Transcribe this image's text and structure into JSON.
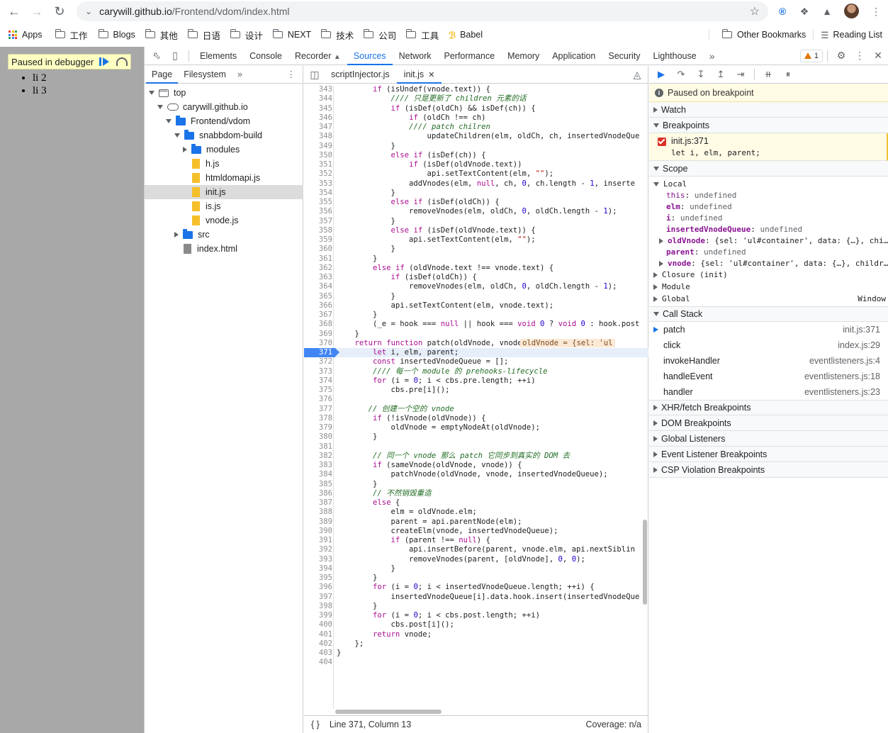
{
  "browser": {
    "url_host": "carywill.github.io",
    "url_path": "/Frontend/vdom/index.html",
    "bookmarks": [
      "Apps",
      "工作",
      "Blogs",
      "其他",
      "日语",
      "设计",
      "NEXT",
      "技术",
      "公司",
      "工具",
      "Babel"
    ],
    "other_bookmarks": "Other Bookmarks",
    "reading_list": "Reading List"
  },
  "page": {
    "paused_text": "Paused in debugger",
    "items": [
      "li 2",
      "li 3"
    ]
  },
  "devtools": {
    "tabs": [
      "Elements",
      "Console",
      "Recorder",
      "Sources",
      "Network",
      "Performance",
      "Memory",
      "Application",
      "Security",
      "Lighthouse"
    ],
    "active_tab": "Sources",
    "warnings": "1",
    "nav_tabs": [
      "Page",
      "Filesystem"
    ],
    "tree": [
      "top",
      "carywill.github.io",
      "Frontend/vdom",
      "snabbdom-build",
      "modules",
      "h.js",
      "htmldomapi.js",
      "init.js",
      "is.js",
      "vnode.js",
      "src",
      "index.html"
    ],
    "editor_tabs": [
      "scriptInjector.js",
      "init.js"
    ],
    "status_position": "Line 371, Column 13",
    "coverage": "Coverage: n/a",
    "inline_value": "oldVnode = {sel: 'ul",
    "code": [
      {
        "n": "343",
        "t": "        if (isUndef(vnode.text)) {"
      },
      {
        "n": "344",
        "t": "            //// 只是更新了 children 元素的话"
      },
      {
        "n": "345",
        "t": "            if (isDef(oldCh) && isDef(ch)) {"
      },
      {
        "n": "346",
        "t": "                if (oldCh !== ch)"
      },
      {
        "n": "347",
        "t": "                //// patch chilren"
      },
      {
        "n": "348",
        "t": "                    updateChildren(elm, oldCh, ch, insertedVnodeQue"
      },
      {
        "n": "349",
        "t": "            }"
      },
      {
        "n": "350",
        "t": "            else if (isDef(ch)) {"
      },
      {
        "n": "351",
        "t": "                if (isDef(oldVnode.text))"
      },
      {
        "n": "352",
        "t": "                    api.setTextContent(elm, \"\");"
      },
      {
        "n": "353",
        "t": "                addVnodes(elm, null, ch, 0, ch.length - 1, inserte"
      },
      {
        "n": "354",
        "t": "            }"
      },
      {
        "n": "355",
        "t": "            else if (isDef(oldCh)) {"
      },
      {
        "n": "356",
        "t": "                removeVnodes(elm, oldCh, 0, oldCh.length - 1);"
      },
      {
        "n": "357",
        "t": "            }"
      },
      {
        "n": "358",
        "t": "            else if (isDef(oldVnode.text)) {"
      },
      {
        "n": "359",
        "t": "                api.setTextContent(elm, \"\");"
      },
      {
        "n": "360",
        "t": "            }"
      },
      {
        "n": "361",
        "t": "        }"
      },
      {
        "n": "362",
        "t": "        else if (oldVnode.text !== vnode.text) {"
      },
      {
        "n": "363",
        "t": "            if (isDef(oldCh)) {"
      },
      {
        "n": "364",
        "t": "                removeVnodes(elm, oldCh, 0, oldCh.length - 1);"
      },
      {
        "n": "365",
        "t": "            }"
      },
      {
        "n": "366",
        "t": "            api.setTextContent(elm, vnode.text);"
      },
      {
        "n": "367",
        "t": "        }"
      },
      {
        "n": "368",
        "t": "        (_e = hook === null || hook === void 0 ? void 0 : hook.post"
      },
      {
        "n": "369",
        "t": "    }"
      },
      {
        "n": "370",
        "t": "    return function patch(oldVnode, vnode) {"
      },
      {
        "n": "371",
        "t": "        let i, elm, parent;"
      },
      {
        "n": "372",
        "t": "        const insertedVnodeQueue = [];"
      },
      {
        "n": "373",
        "t": "        //// 每一个 module 的 prehooks-lifecycle"
      },
      {
        "n": "374",
        "t": "        for (i = 0; i < cbs.pre.length; ++i)"
      },
      {
        "n": "375",
        "t": "            cbs.pre[i]();"
      },
      {
        "n": "376",
        "t": ""
      },
      {
        "n": "377",
        "t": "       // 创建一个空的 vnode"
      },
      {
        "n": "378",
        "t": "        if (!isVnode(oldVnode)) {"
      },
      {
        "n": "379",
        "t": "            oldVnode = emptyNodeAt(oldVnode);"
      },
      {
        "n": "380",
        "t": "        }"
      },
      {
        "n": "381",
        "t": ""
      },
      {
        "n": "382",
        "t": "        // 同一个 vnode 那么 patch 它同步到真实的 DOM 去"
      },
      {
        "n": "383",
        "t": "        if (sameVnode(oldVnode, vnode)) {"
      },
      {
        "n": "384",
        "t": "            patchVnode(oldVnode, vnode, insertedVnodeQueue);"
      },
      {
        "n": "385",
        "t": "        }"
      },
      {
        "n": "386",
        "t": "        // 不然销毁重造"
      },
      {
        "n": "387",
        "t": "        else {"
      },
      {
        "n": "388",
        "t": "            elm = oldVnode.elm;"
      },
      {
        "n": "389",
        "t": "            parent = api.parentNode(elm);"
      },
      {
        "n": "390",
        "t": "            createElm(vnode, insertedVnodeQueue);"
      },
      {
        "n": "391",
        "t": "            if (parent !== null) {"
      },
      {
        "n": "392",
        "t": "                api.insertBefore(parent, vnode.elm, api.nextSiblin"
      },
      {
        "n": "393",
        "t": "                removeVnodes(parent, [oldVnode], 0, 0);"
      },
      {
        "n": "394",
        "t": "            }"
      },
      {
        "n": "395",
        "t": "        }"
      },
      {
        "n": "396",
        "t": "        for (i = 0; i < insertedVnodeQueue.length; ++i) {"
      },
      {
        "n": "397",
        "t": "            insertedVnodeQueue[i].data.hook.insert(insertedVnodeQue"
      },
      {
        "n": "398",
        "t": "        }"
      },
      {
        "n": "399",
        "t": "        for (i = 0; i < cbs.post.length; ++i)"
      },
      {
        "n": "400",
        "t": "            cbs.post[i]();"
      },
      {
        "n": "401",
        "t": "        return vnode;"
      },
      {
        "n": "402",
        "t": "    };"
      },
      {
        "n": "403",
        "t": "}"
      },
      {
        "n": "404",
        "t": ""
      }
    ],
    "paused_banner": "Paused on breakpoint",
    "sections": {
      "watch": "Watch",
      "breakpoints": "Breakpoints",
      "scope": "Scope",
      "call_stack": "Call Stack",
      "xhr": "XHR/fetch Breakpoints",
      "dom": "DOM Breakpoints",
      "global_listeners": "Global Listeners",
      "event_listener": "Event Listener Breakpoints",
      "csp": "CSP Violation Breakpoints"
    },
    "breakpoint": {
      "loc": "init.js:371",
      "code": "let i, elm, parent;"
    },
    "scope": {
      "local": "Local",
      "rows": [
        {
          "k": "this",
          "v": "undefined"
        },
        {
          "k": "elm",
          "v": "undefined"
        },
        {
          "k": "i",
          "v": "undefined"
        },
        {
          "k": "insertedVnodeQueue",
          "v": "undefined"
        },
        {
          "k": "oldVnode",
          "v": "{sel: 'ul#container', data: {…}, chi…"
        },
        {
          "k": "parent",
          "v": "undefined"
        },
        {
          "k": "vnode",
          "v": "{sel: 'ul#container', data: {…}, childr…"
        }
      ],
      "closure": "Closure (init)",
      "module": "Module",
      "global": "Global",
      "global_val": "Window"
    },
    "call_stack": [
      {
        "fn": "patch",
        "loc": "init.js:371"
      },
      {
        "fn": "click",
        "loc": "index.js:29"
      },
      {
        "fn": "invokeHandler",
        "loc": "eventlisteners.js:4"
      },
      {
        "fn": "handleEvent",
        "loc": "eventlisteners.js:18"
      },
      {
        "fn": "handler",
        "loc": "eventlisteners.js:23"
      }
    ]
  }
}
